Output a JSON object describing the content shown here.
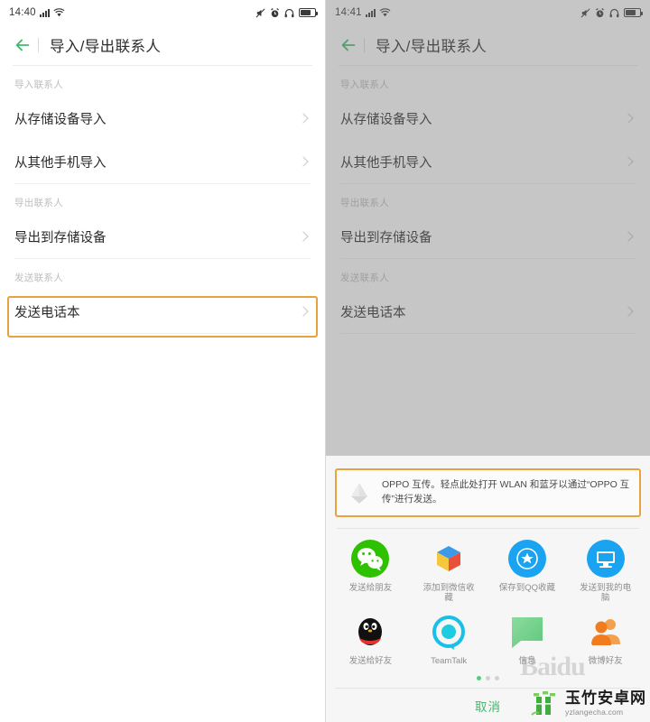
{
  "left": {
    "status": {
      "time": "14:40",
      "icons": [
        "signal-icon",
        "wifi-icon",
        "mute-icon",
        "alarm-icon",
        "headphones-icon",
        "battery-icon"
      ]
    },
    "appbar": {
      "back": "back-arrow-icon",
      "title": "导入/导出联系人"
    },
    "sections": [
      {
        "label": "导入联系人",
        "items": [
          {
            "label": "从存储设备导入"
          },
          {
            "label": "从其他手机导入"
          }
        ]
      },
      {
        "label": "导出联系人",
        "items": [
          {
            "label": "导出到存储设备"
          }
        ]
      },
      {
        "label": "发送联系人",
        "items": [
          {
            "label": "发送电话本",
            "highlighted": true
          }
        ]
      }
    ]
  },
  "right": {
    "status": {
      "time": "14:41"
    },
    "appbar": {
      "title": "导入/导出联系人"
    },
    "sections": [
      {
        "label": "导入联系人",
        "items": [
          {
            "label": "从存储设备导入"
          },
          {
            "label": "从其他手机导入"
          }
        ]
      },
      {
        "label": "导出联系人",
        "items": [
          {
            "label": "导出到存储设备"
          }
        ]
      },
      {
        "label": "发送联系人",
        "items": [
          {
            "label": "发送电话本"
          }
        ]
      }
    ],
    "sheet": {
      "banner": {
        "icon": "oppo-share-icon",
        "text": "OPPO 互传。轻点此处打开 WLAN 和蓝牙以通过“OPPO 互传”进行发送。"
      },
      "apps": [
        {
          "icon": "wechat-icon",
          "label": "发送给朋友"
        },
        {
          "icon": "favorites-cube-icon",
          "label": "添加到微信收藏"
        },
        {
          "icon": "qq-favorites-icon",
          "label": "保存到QQ收藏"
        },
        {
          "icon": "my-computer-icon",
          "label": "发送到我的电脑"
        },
        {
          "icon": "qq-icon",
          "label": "发送给好友"
        },
        {
          "icon": "teamtalk-icon",
          "label": "TeamTalk"
        },
        {
          "icon": "messages-icon",
          "label": "信息"
        },
        {
          "icon": "weibo-friends-icon",
          "label": "微博好友"
        }
      ],
      "pages": {
        "count": 3,
        "active": 0
      },
      "cancel_label": "取消"
    }
  },
  "watermarks": {
    "baidu": "Baidu",
    "brand_cn": "玉竹安卓网",
    "brand_en": "yzlangecha.com"
  },
  "colors": {
    "accent_green": "#3fba6b",
    "highlight_orange": "#e8a33d",
    "dim": "#787878"
  }
}
